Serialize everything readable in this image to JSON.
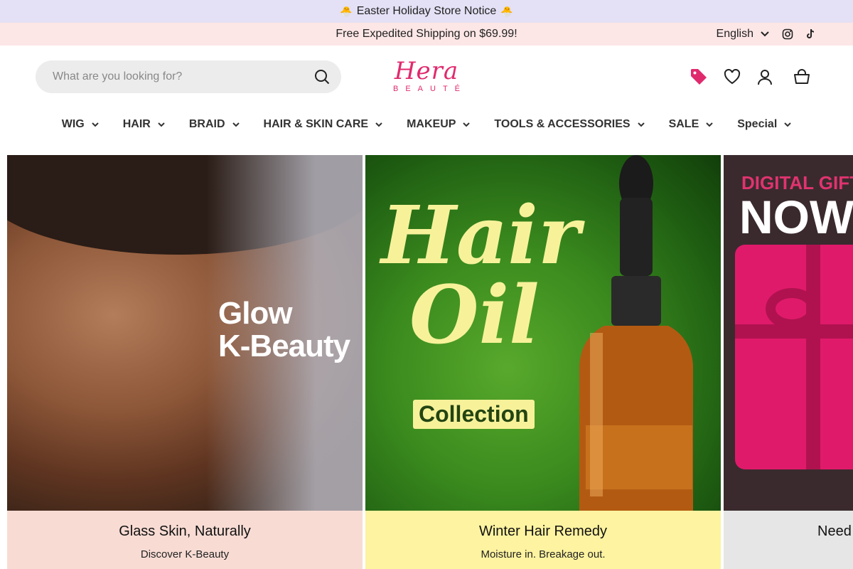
{
  "notice": {
    "text": "Easter Holiday Store Notice",
    "emoji": "🐣"
  },
  "ship_bar": {
    "text": "Free Expedited Shipping on $69.99!",
    "language": "English"
  },
  "search": {
    "placeholder": "What are you looking for?"
  },
  "logo": {
    "main": "Hera",
    "sub": "BEAUTÉ"
  },
  "nav": [
    {
      "label": "WIG"
    },
    {
      "label": "HAIR"
    },
    {
      "label": "BRAID"
    },
    {
      "label": "HAIR & SKIN CARE"
    },
    {
      "label": "MAKEUP"
    },
    {
      "label": "TOOLS & ACCESSORIES"
    },
    {
      "label": "SALE"
    },
    {
      "label": "Special"
    }
  ],
  "cards": [
    {
      "overlay_line1": "Glow",
      "overlay_line2": "K-Beauty",
      "title": "Glass Skin, Naturally",
      "subtitle": "Discover K-Beauty",
      "footer_color": "#f8dcd4"
    },
    {
      "overlay_line1": "Hair",
      "overlay_line2": "Oil",
      "badge": "Collection",
      "title": "Winter Hair Remedy",
      "subtitle": "Moisture in. Breakage out.",
      "footer_color": "#fdf3a0"
    },
    {
      "overlay_line1": "DIGITAL GIFT",
      "overlay_line2": "NOW",
      "title": "Need"
    }
  ],
  "colors": {
    "brand_pink": "#e02a6e",
    "notice_bg": "#e4e0f5",
    "ship_bg": "#fde6e6"
  },
  "icons": [
    "instagram-icon",
    "tiktok-icon",
    "search-icon",
    "tag-icon",
    "heart-icon",
    "user-icon",
    "cart-icon",
    "chevron-down-icon"
  ]
}
